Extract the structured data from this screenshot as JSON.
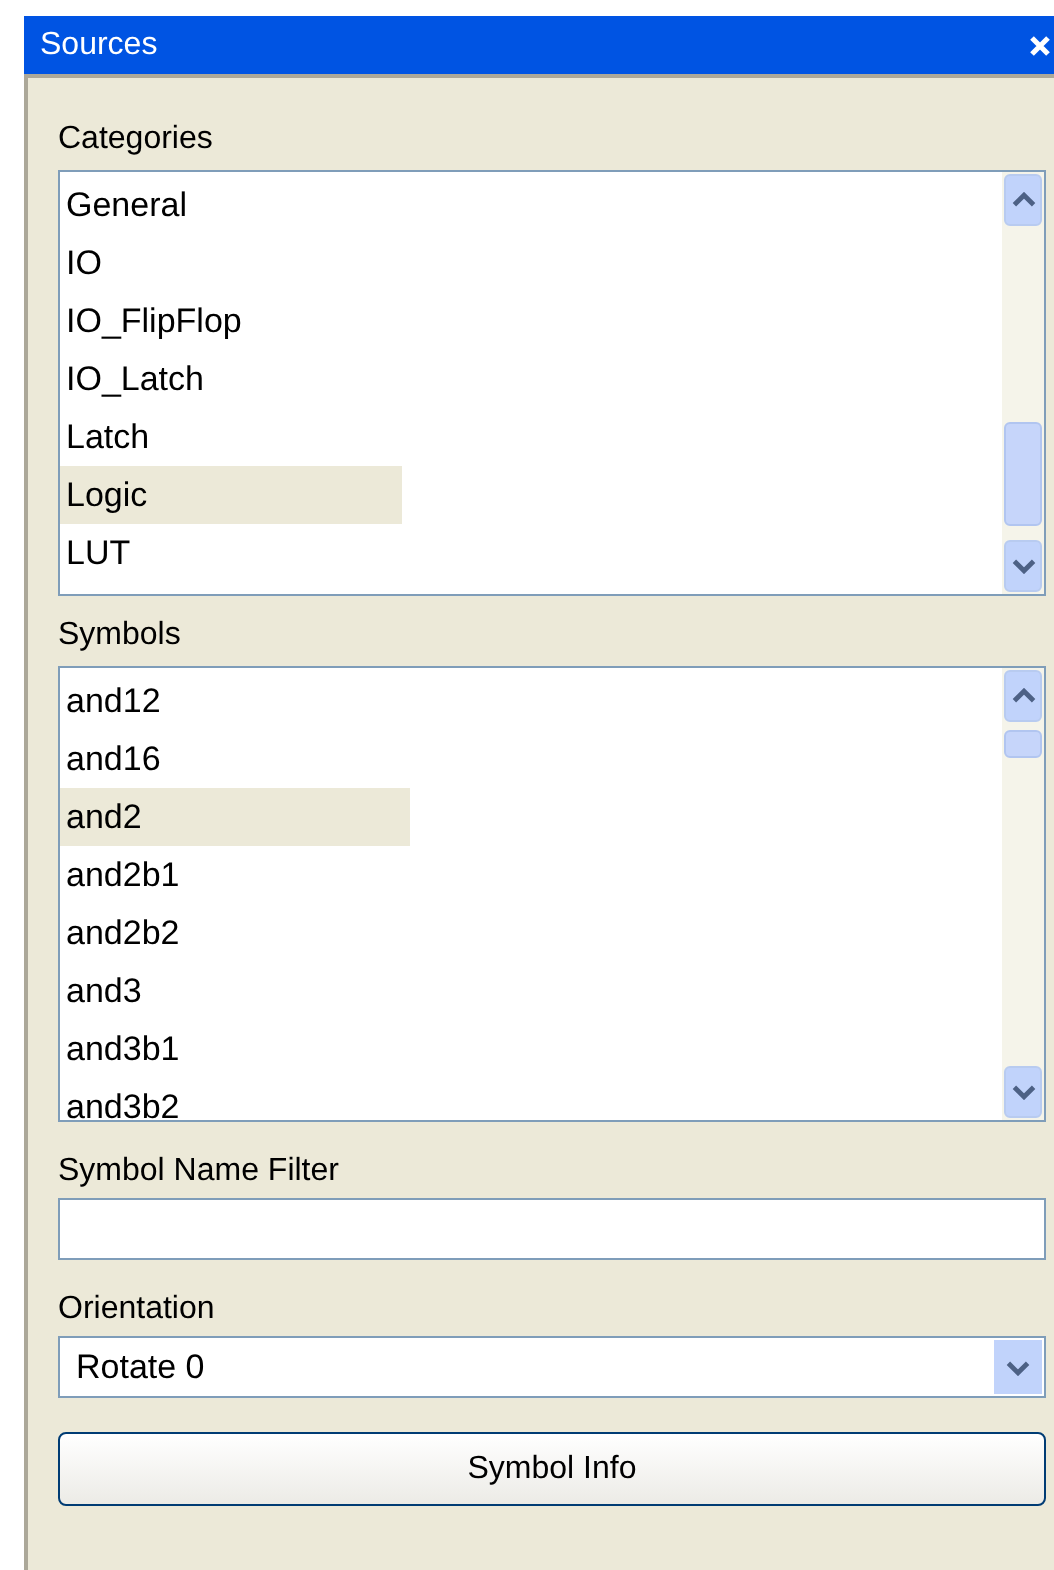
{
  "window": {
    "title": "Sources"
  },
  "categories": {
    "label": "Categories",
    "items": [
      {
        "label": "General",
        "selected": false
      },
      {
        "label": "IO",
        "selected": false
      },
      {
        "label": "IO_FlipFlop",
        "selected": false
      },
      {
        "label": "IO_Latch",
        "selected": false
      },
      {
        "label": "Latch",
        "selected": false
      },
      {
        "label": "Logic",
        "selected": true
      },
      {
        "label": "LUT",
        "selected": false
      }
    ]
  },
  "symbols": {
    "label": "Symbols",
    "items": [
      {
        "label": "and12",
        "selected": false
      },
      {
        "label": "and16",
        "selected": false
      },
      {
        "label": "and2",
        "selected": true
      },
      {
        "label": "and2b1",
        "selected": false
      },
      {
        "label": "and2b2",
        "selected": false
      },
      {
        "label": "and3",
        "selected": false
      },
      {
        "label": "and3b1",
        "selected": false
      },
      {
        "label": "and3b2",
        "selected": false
      }
    ]
  },
  "filter": {
    "label": "Symbol Name Filter"
  },
  "orientation": {
    "label": "Orientation",
    "value": "Rotate 0"
  },
  "buttons": [
    "Symbol Info"
  ]
}
